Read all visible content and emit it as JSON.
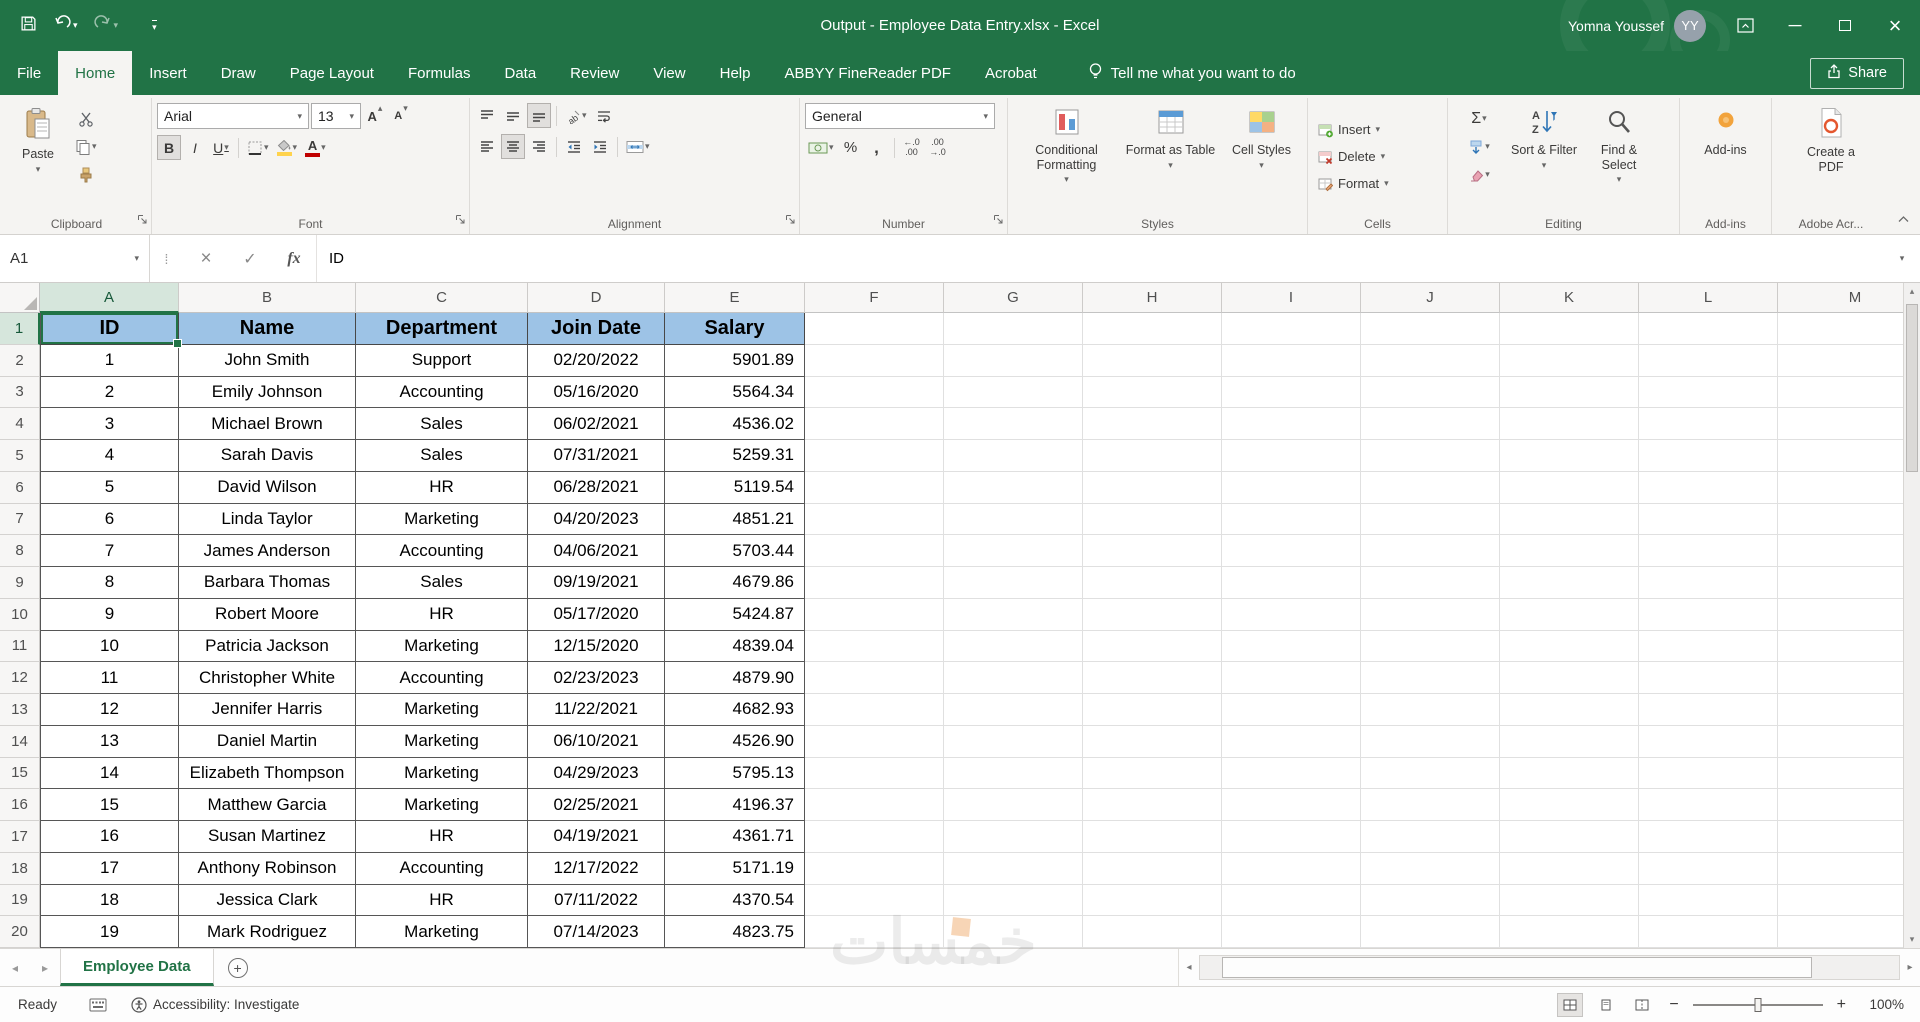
{
  "title_bar": {
    "title": "Output - Employee Data Entry.xlsx - Excel",
    "user_name": "Yomna Youssef",
    "user_initials": "YY"
  },
  "tabs": {
    "items": [
      "File",
      "Home",
      "Insert",
      "Draw",
      "Page Layout",
      "Formulas",
      "Data",
      "Review",
      "View",
      "Help",
      "ABBYY FineReader PDF",
      "Acrobat"
    ],
    "active": "Home",
    "tell_me": "Tell me what you want to do",
    "share": "Share"
  },
  "ribbon": {
    "font_name": "Arial",
    "font_size": "13",
    "number_format": "General",
    "bold": "B",
    "italic": "I",
    "underline": "U",
    "buttons": {
      "paste": "Paste",
      "conditional_formatting": "Conditional Formatting",
      "format_as_table": "Format as Table",
      "cell_styles": "Cell Styles",
      "insert": "Insert",
      "delete": "Delete",
      "format": "Format",
      "sort_filter": "Sort & Filter",
      "find_select": "Find & Select",
      "add_ins": "Add-ins",
      "create_pdf": "Create a PDF"
    },
    "groups": {
      "clipboard": "Clipboard",
      "font": "Font",
      "alignment": "Alignment",
      "number": "Number",
      "styles": "Styles",
      "cells": "Cells",
      "editing": "Editing",
      "addins": "Add-ins",
      "adobe": "Adobe Acr..."
    }
  },
  "formula_bar": {
    "name_box": "A1",
    "fx": "fx",
    "content": "ID"
  },
  "sheet": {
    "columns": [
      "A",
      "B",
      "C",
      "D",
      "E",
      "F",
      "G",
      "H",
      "I",
      "J",
      "K",
      "L",
      "M"
    ],
    "header_row": [
      "ID",
      "Name",
      "Department",
      "Join Date",
      "Salary"
    ],
    "rows": [
      [
        "1",
        "John Smith",
        "Support",
        "02/20/2022",
        "5901.89"
      ],
      [
        "2",
        "Emily Johnson",
        "Accounting",
        "05/16/2020",
        "5564.34"
      ],
      [
        "3",
        "Michael Brown",
        "Sales",
        "06/02/2021",
        "4536.02"
      ],
      [
        "4",
        "Sarah Davis",
        "Sales",
        "07/31/2021",
        "5259.31"
      ],
      [
        "5",
        "David Wilson",
        "HR",
        "06/28/2021",
        "5119.54"
      ],
      [
        "6",
        "Linda Taylor",
        "Marketing",
        "04/20/2023",
        "4851.21"
      ],
      [
        "7",
        "James Anderson",
        "Accounting",
        "04/06/2021",
        "5703.44"
      ],
      [
        "8",
        "Barbara Thomas",
        "Sales",
        "09/19/2021",
        "4679.86"
      ],
      [
        "9",
        "Robert Moore",
        "HR",
        "05/17/2020",
        "5424.87"
      ],
      [
        "10",
        "Patricia Jackson",
        "Marketing",
        "12/15/2020",
        "4839.04"
      ],
      [
        "11",
        "Christopher White",
        "Accounting",
        "02/23/2023",
        "4879.90"
      ],
      [
        "12",
        "Jennifer Harris",
        "Marketing",
        "11/22/2021",
        "4682.93"
      ],
      [
        "13",
        "Daniel Martin",
        "Marketing",
        "06/10/2021",
        "4526.90"
      ],
      [
        "14",
        "Elizabeth Thompson",
        "Marketing",
        "04/29/2023",
        "5795.13"
      ],
      [
        "15",
        "Matthew Garcia",
        "Marketing",
        "02/25/2021",
        "4196.37"
      ],
      [
        "16",
        "Susan Martinez",
        "HR",
        "04/19/2021",
        "4361.71"
      ],
      [
        "17",
        "Anthony Robinson",
        "Accounting",
        "12/17/2022",
        "5171.19"
      ],
      [
        "18",
        "Jessica Clark",
        "HR",
        "07/11/2022",
        "4370.54"
      ],
      [
        "19",
        "Mark Rodriguez",
        "Marketing",
        "07/14/2023",
        "4823.75"
      ]
    ]
  },
  "sheet_bar": {
    "active_tab": "Employee Data"
  },
  "status_bar": {
    "mode": "Ready",
    "accessibility": "Accessibility: Investigate",
    "zoom": "100%"
  },
  "watermark": "خمسات",
  "colors": {
    "excel_green": "#217346",
    "header_fill": "#9DC3E6",
    "selection": "#217346"
  }
}
